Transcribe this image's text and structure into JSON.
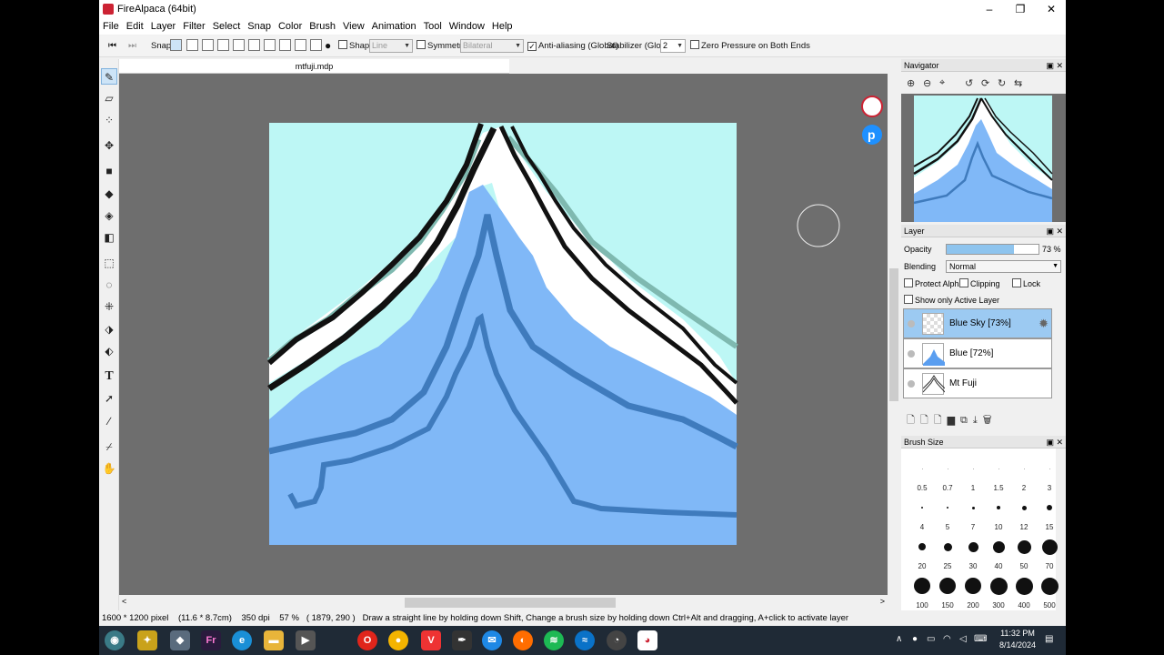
{
  "window": {
    "title": "FireAlpaca (64bit)",
    "minimize": "–",
    "maximize": "❐",
    "close": "✕"
  },
  "menu": [
    "File",
    "Edit",
    "Layer",
    "Filter",
    "Select",
    "Snap",
    "Color",
    "Brush",
    "View",
    "Animation",
    "Tool",
    "Window",
    "Help"
  ],
  "toolbar": {
    "snap_label": "Snap",
    "shape_label": "Shape",
    "shape_value": "Line",
    "symmetry_label": "Symmetry",
    "symmetry_value": "Bilateral",
    "antialias_label": "Anti-aliasing (Global)",
    "stabilizer_label": "Stabilizer (Global)",
    "stabilizer_value": "2",
    "zero_pressure_label": "Zero Pressure on Both Ends"
  },
  "document": {
    "tab": "mtfuji.mdp"
  },
  "navigator": {
    "title": "Navigator"
  },
  "layer_panel": {
    "title": "Layer",
    "opacity_label": "Opacity",
    "opacity_value": "73 %",
    "opacity_fraction": 0.73,
    "blending_label": "Blending",
    "blending_value": "Normal",
    "protect_alpha": "Protect Alpha",
    "clipping": "Clipping",
    "lock": "Lock",
    "show_active": "Show only Active Layer",
    "layers": [
      {
        "name": "Blue Sky [73%]",
        "selected": true
      },
      {
        "name": "Blue [72%]",
        "selected": false
      },
      {
        "name": "Mt Fuji",
        "selected": false
      }
    ]
  },
  "brush_panel": {
    "title": "Brush Size",
    "sizes": [
      "0.5",
      "0.7",
      "1",
      "1.5",
      "2",
      "3",
      "4",
      "5",
      "7",
      "10",
      "12",
      "15",
      "20",
      "25",
      "30",
      "40",
      "50",
      "70",
      "100",
      "150",
      "200",
      "300",
      "400",
      "500"
    ]
  },
  "status": {
    "size": "1600 * 1200 pixel",
    "physical": "(11.6 * 8.7cm)",
    "dpi": "350 dpi",
    "zoom": "57 %",
    "coords": "( 1879, 290 )",
    "hint": "Draw a straight line by holding down Shift, Change a brush size by holding down Ctrl+Alt and dragging, A+click to activate layer"
  },
  "taskbar": {
    "time": "11:32 PM",
    "date": "8/14/2024"
  },
  "colors": {
    "sky": "#bdf7f5",
    "mountain_blue": "#80b8f7",
    "river_blue": "#3f7bbd",
    "outline": "#111111",
    "teal": "#7fb9b0",
    "selection": "#9ccaf2"
  }
}
